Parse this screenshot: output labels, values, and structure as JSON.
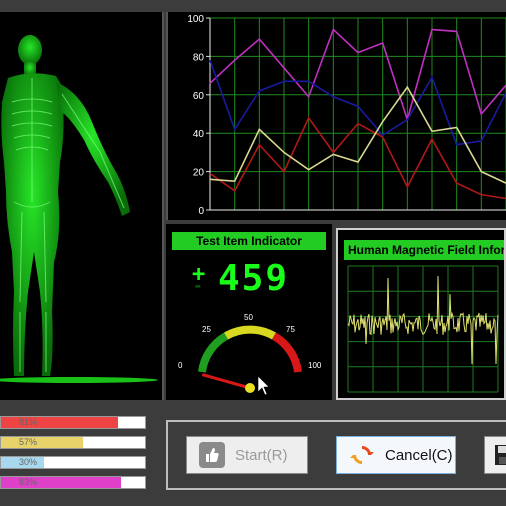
{
  "test_indicator": {
    "title": "Test Item Indicator",
    "sign_plus": "+",
    "sign_minus": "-",
    "value": "459",
    "gauge": {
      "labels": [
        "0",
        "25",
        "50",
        "75",
        "100"
      ],
      "needle_value": 8
    }
  },
  "magnetic_field": {
    "title": "Human Magnetic Field Infor"
  },
  "progress_bars": [
    {
      "label": "81%",
      "value": 81,
      "fill": "#ef4444"
    },
    {
      "label": "57%",
      "value": 57,
      "fill": "#e8d36a"
    },
    {
      "label": "30%",
      "value": 30,
      "fill": "#a8d8f0"
    },
    {
      "label": "83%",
      "value": 83,
      "fill": "#e040c8"
    }
  ],
  "buttons": {
    "start": "Start(R)",
    "cancel": "Cancel(C)"
  },
  "chart_data": {
    "type": "line",
    "x": [
      0,
      1,
      2,
      3,
      4,
      5,
      6,
      7,
      8,
      9,
      10,
      11,
      12
    ],
    "ylim": [
      0,
      100
    ],
    "yticks": [
      "0",
      "20",
      "40",
      "60",
      "80",
      "100"
    ],
    "grid": true,
    "series": [
      {
        "color": "#c030c0",
        "values": [
          66,
          78,
          89,
          74,
          59,
          94,
          82,
          87,
          47,
          94,
          93,
          50,
          65
        ]
      },
      {
        "color": "#1a1aa0",
        "values": [
          78,
          42,
          62,
          67,
          67,
          59,
          54,
          39,
          47,
          69,
          34,
          36,
          61
        ]
      },
      {
        "color": "#b01818",
        "values": [
          19,
          10,
          34,
          20,
          48,
          30,
          45,
          38,
          12,
          37,
          14,
          8,
          6
        ]
      },
      {
        "color": "#d8d890",
        "values": [
          16,
          15,
          42,
          30,
          21,
          29,
          25,
          46,
          64,
          41,
          43,
          20,
          14
        ]
      }
    ]
  },
  "colors": {
    "accent_green": "#22cc22",
    "digit_green": "#1aff1a"
  }
}
